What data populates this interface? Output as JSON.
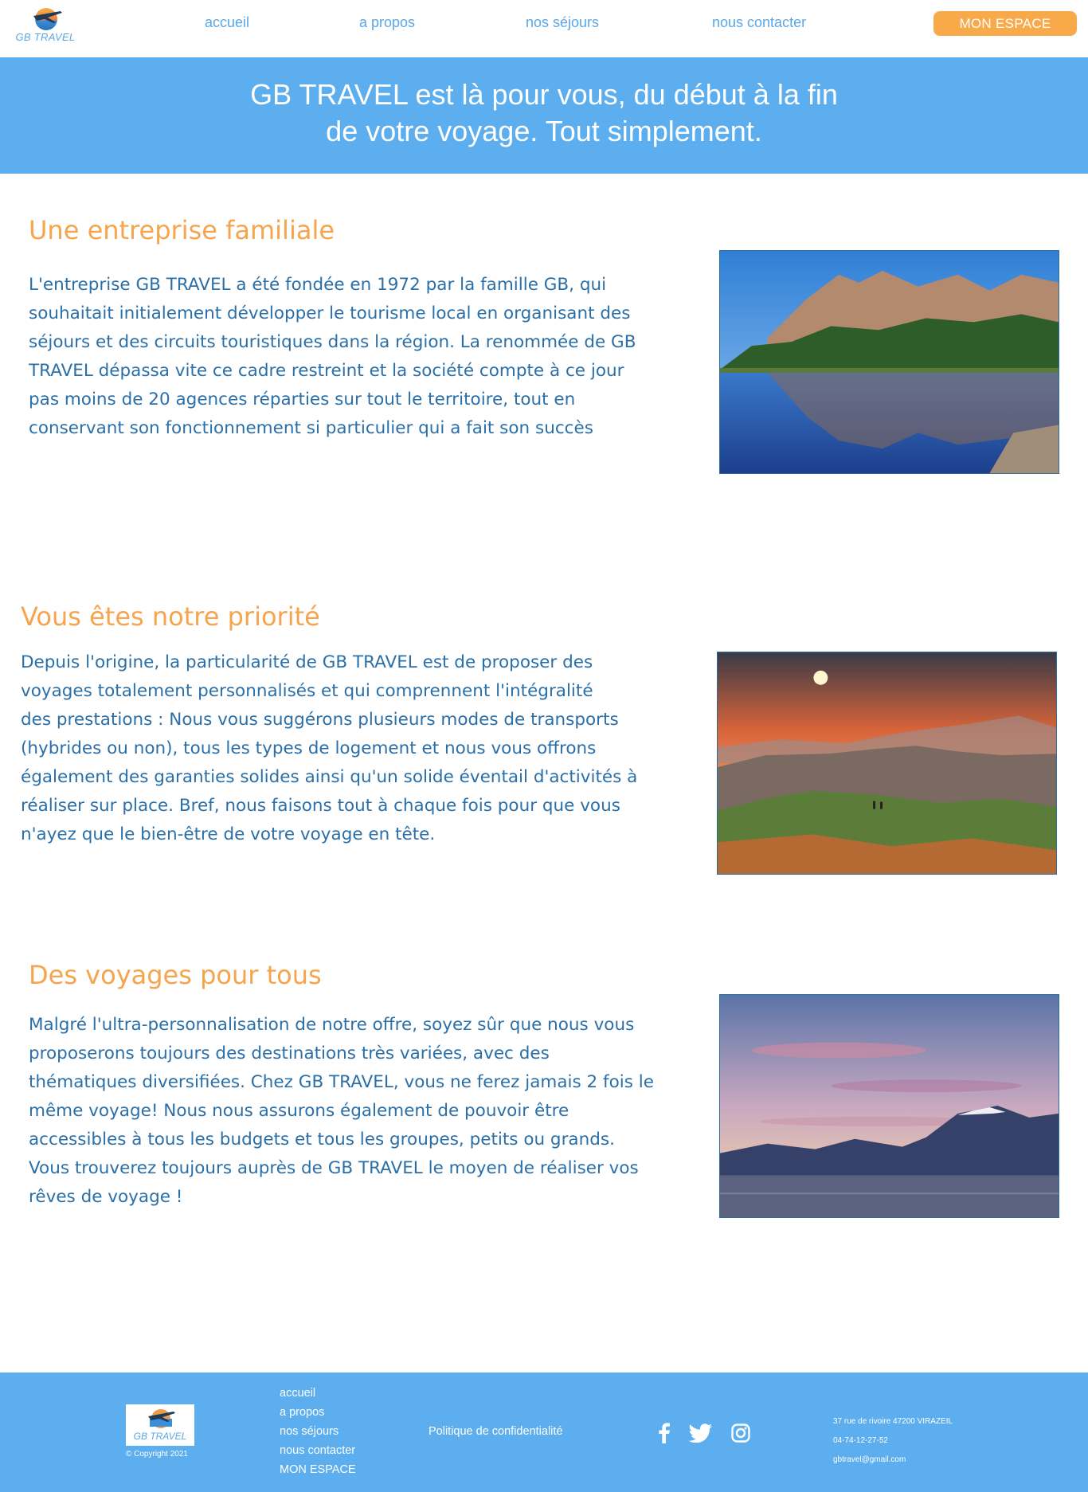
{
  "brand": {
    "name": "GB TRAVEL"
  },
  "nav": {
    "items": [
      "accueil",
      "a propos",
      "nos séjours",
      "nous contacter"
    ],
    "cta": "MON ESPACE"
  },
  "hero": {
    "line1": "GB TRAVEL est là pour vous, du début à la fin",
    "line2": "de votre voyage. Tout simplement."
  },
  "sections": [
    {
      "title": "Une entreprise familiale",
      "lines": [
        "L'entreprise GB TRAVEL a été fondée en 1972 par la famille GB, qui",
        "souhaitait initialement développer le tourisme local en organisant des",
        "séjours et des circuits touristiques dans la région. La renommée de GB",
        "TRAVEL dépassa vite ce cadre restreint et la société compte à ce jour",
        "pas moins de 20 agences réparties sur tout le territoire, tout en",
        "conservant son fonctionnement si particulier qui a fait son succès"
      ],
      "image": "desert-oasis-lake"
    },
    {
      "title": "Vous êtes notre priorité",
      "lines": [
        "Depuis l'origine, la particularité de GB TRAVEL est de proposer des",
        "voyages totalement personnalisés et qui comprennent l'intégralité",
        "des prestations : Nous vous suggérons plusieurs modes de transports",
        "(hybrides ou non), tous les types de logement et nous vous offrons",
        "également des garanties solides ainsi qu'un solide éventail d'activités à",
        "réaliser sur place. Bref, nous faisons tout à chaque fois pour que vous",
        "n'ayez que le bien-être de votre voyage en tête."
      ],
      "image": "sunset-cliff-town"
    },
    {
      "title": "Des voyages pour tous",
      "lines": [
        "Malgré l'ultra-personnalisation de notre offre, soyez sûr que nous vous",
        "proposerons toujours des destinations très variées, avec des",
        "thématiques diversifiées. Chez GB TRAVEL, vous ne ferez jamais 2 fois le",
        "même voyage! Nous nous assurons également de pouvoir être",
        "accessibles à tous les budgets et tous les groupes, petits ou grands.",
        "Vous trouverez toujours auprès de GB TRAVEL le moyen de réaliser vos",
        "rêves de voyage !"
      ],
      "image": "mountain-lake-dusk"
    }
  ],
  "footer": {
    "copyright": "© Copyright 2021",
    "links": [
      "accueil",
      "a propos",
      "nos séjours",
      "nous contacter",
      "MON ESPACE"
    ],
    "privacy": "Politique de confidentialité",
    "social": [
      "facebook-icon",
      "twitter-icon",
      "instagram-icon"
    ],
    "contact": {
      "address": "37 rue de rivoire 47200 VIRAZEIL",
      "phone": "04-74-12-27-52",
      "email": "gbtravel@gmail.com"
    }
  },
  "colors": {
    "accent_orange": "#f8a94a",
    "brand_blue": "#5daeee",
    "text_blue": "#2a6fa8"
  }
}
